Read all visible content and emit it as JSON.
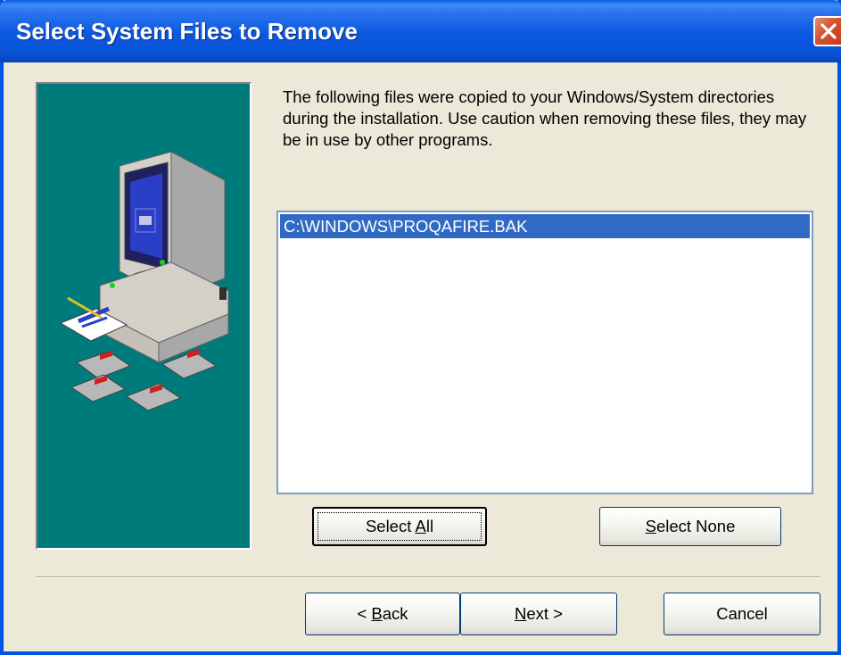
{
  "window": {
    "title": "Select System Files to Remove"
  },
  "description": "The following files were copied to your Windows/System directories during the installation.  Use caution when removing these files, they may be in use by other programs.",
  "file_list": {
    "items": [
      "C:\\WINDOWS\\PROQAFIRE.BAK"
    ],
    "selected_index": 0
  },
  "buttons": {
    "select_all": {
      "pre": "Select ",
      "key": "A",
      "post": "ll"
    },
    "select_none": {
      "pre": "",
      "key": "S",
      "post": "elect None"
    },
    "back": {
      "pre": "< ",
      "key": "B",
      "post": "ack"
    },
    "next": {
      "pre": "",
      "key": "N",
      "post": "ext >"
    },
    "cancel": "Cancel"
  },
  "colors": {
    "titlebar": "#0a53d6",
    "art_panel": "#007b7b",
    "selection": "#316ac5",
    "dialog_face": "#ece9d8"
  },
  "icons": {
    "close": "close-icon",
    "illustration": "computer-with-floppy-disks-illustration"
  }
}
